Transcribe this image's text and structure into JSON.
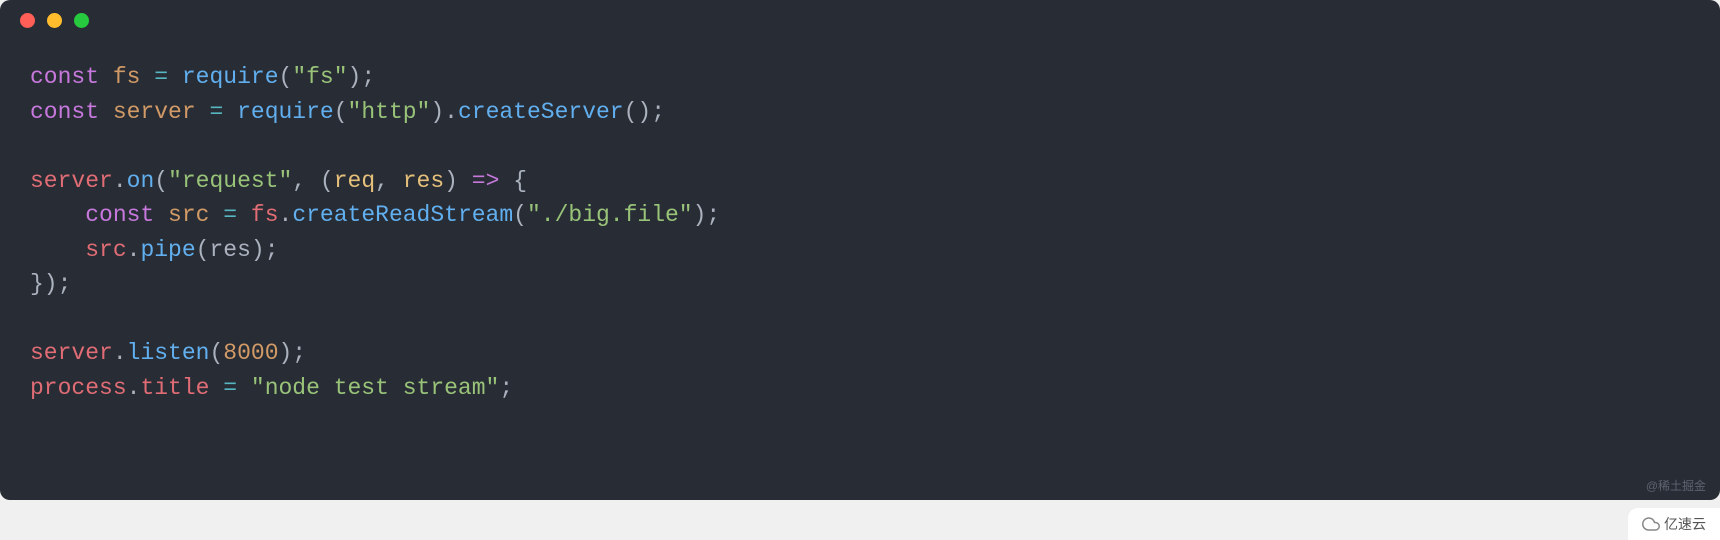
{
  "window": {
    "traffic_lights": [
      "close",
      "minimize",
      "maximize"
    ]
  },
  "code": {
    "lines": [
      [
        {
          "cls": "tok-keyword",
          "t": "const"
        },
        {
          "cls": "tok-punct",
          "t": " "
        },
        {
          "cls": "tok-variable2",
          "t": "fs"
        },
        {
          "cls": "tok-punct",
          "t": " "
        },
        {
          "cls": "tok-operator",
          "t": "="
        },
        {
          "cls": "tok-punct",
          "t": " "
        },
        {
          "cls": "tok-function",
          "t": "require"
        },
        {
          "cls": "tok-punct",
          "t": "("
        },
        {
          "cls": "tok-string",
          "t": "\"fs\""
        },
        {
          "cls": "tok-punct",
          "t": ");"
        }
      ],
      [
        {
          "cls": "tok-keyword",
          "t": "const"
        },
        {
          "cls": "tok-punct",
          "t": " "
        },
        {
          "cls": "tok-variable2",
          "t": "server"
        },
        {
          "cls": "tok-punct",
          "t": " "
        },
        {
          "cls": "tok-operator",
          "t": "="
        },
        {
          "cls": "tok-punct",
          "t": " "
        },
        {
          "cls": "tok-function",
          "t": "require"
        },
        {
          "cls": "tok-punct",
          "t": "("
        },
        {
          "cls": "tok-string",
          "t": "\"http\""
        },
        {
          "cls": "tok-punct",
          "t": ")."
        },
        {
          "cls": "tok-function",
          "t": "createServer"
        },
        {
          "cls": "tok-punct",
          "t": "();"
        }
      ],
      [],
      [
        {
          "cls": "tok-variable",
          "t": "server"
        },
        {
          "cls": "tok-punct",
          "t": "."
        },
        {
          "cls": "tok-function",
          "t": "on"
        },
        {
          "cls": "tok-punct",
          "t": "("
        },
        {
          "cls": "tok-string",
          "t": "\"request\""
        },
        {
          "cls": "tok-punct",
          "t": ", ("
        },
        {
          "cls": "tok-param",
          "t": "req"
        },
        {
          "cls": "tok-punct",
          "t": ", "
        },
        {
          "cls": "tok-param",
          "t": "res"
        },
        {
          "cls": "tok-punct",
          "t": ") "
        },
        {
          "cls": "tok-keyword",
          "t": "=>"
        },
        {
          "cls": "tok-punct",
          "t": " {"
        }
      ],
      [
        {
          "cls": "tok-punct",
          "t": "    "
        },
        {
          "cls": "tok-keyword",
          "t": "const"
        },
        {
          "cls": "tok-punct",
          "t": " "
        },
        {
          "cls": "tok-variable2",
          "t": "src"
        },
        {
          "cls": "tok-punct",
          "t": " "
        },
        {
          "cls": "tok-operator",
          "t": "="
        },
        {
          "cls": "tok-punct",
          "t": " "
        },
        {
          "cls": "tok-variable",
          "t": "fs"
        },
        {
          "cls": "tok-punct",
          "t": "."
        },
        {
          "cls": "tok-function",
          "t": "createReadStream"
        },
        {
          "cls": "tok-punct",
          "t": "("
        },
        {
          "cls": "tok-string",
          "t": "\"./big.file\""
        },
        {
          "cls": "tok-punct",
          "t": ");"
        }
      ],
      [
        {
          "cls": "tok-punct",
          "t": "    "
        },
        {
          "cls": "tok-variable",
          "t": "src"
        },
        {
          "cls": "tok-punct",
          "t": "."
        },
        {
          "cls": "tok-function",
          "t": "pipe"
        },
        {
          "cls": "tok-punct",
          "t": "("
        },
        {
          "cls": "tok-ident",
          "t": "res"
        },
        {
          "cls": "tok-punct",
          "t": ");"
        }
      ],
      [
        {
          "cls": "tok-punct",
          "t": "});"
        }
      ],
      [],
      [
        {
          "cls": "tok-variable",
          "t": "server"
        },
        {
          "cls": "tok-punct",
          "t": "."
        },
        {
          "cls": "tok-function",
          "t": "listen"
        },
        {
          "cls": "tok-punct",
          "t": "("
        },
        {
          "cls": "tok-number",
          "t": "8000"
        },
        {
          "cls": "tok-punct",
          "t": ");"
        }
      ],
      [
        {
          "cls": "tok-variable",
          "t": "process"
        },
        {
          "cls": "tok-punct",
          "t": "."
        },
        {
          "cls": "tok-property",
          "t": "title"
        },
        {
          "cls": "tok-punct",
          "t": " "
        },
        {
          "cls": "tok-operator",
          "t": "="
        },
        {
          "cls": "tok-punct",
          "t": " "
        },
        {
          "cls": "tok-string",
          "t": "\"node test stream\""
        },
        {
          "cls": "tok-punct",
          "t": ";"
        }
      ]
    ]
  },
  "watermarks": {
    "source": "@稀土掘金",
    "brand": "亿速云"
  }
}
